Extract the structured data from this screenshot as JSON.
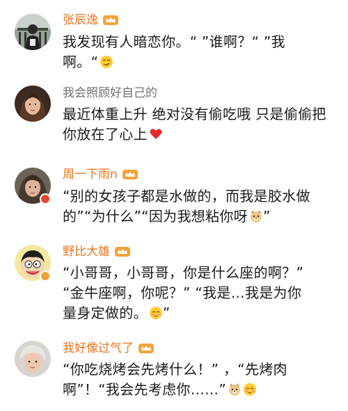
{
  "comments": [
    {
      "name": "张辰逸",
      "name_style": "orange",
      "has_vip": true,
      "lines": [
        "我发现有人暗恋你。“ ”谁啊？“ ”我",
        "啊。“"
      ],
      "emoji": "sly-smile-emoji"
    },
    {
      "name": "我会照顾好自己的",
      "name_style": "gray",
      "has_vip": false,
      "lines": [
        "最近体重上升 绝对没有偷吃哦 只是偷偷把",
        "你放在了心上"
      ],
      "emoji": "heart-icon"
    },
    {
      "name": "周一下雨n",
      "name_style": "orange",
      "has_vip": true,
      "lines": [
        "“别的女孩子都是水做的，而我是胶水做",
        "的”“为什么”“因为我想粘你呀",
        "”"
      ],
      "emoji": "doge-emoji"
    },
    {
      "name": "野比大雄",
      "name_style": "orange",
      "has_vip": true,
      "lines": [
        "“小哥哥，小哥哥，你是什么座的啊？”",
        "“金牛座啊，你呢？” “我是…我是为你",
        "量身定做的。",
        "”"
      ],
      "emoji": "shy-emoji"
    },
    {
      "name": "我好像过气了",
      "name_style": "orange",
      "has_vip": true,
      "lines": [
        "“你吃烧烤会先烤什么！”  ，“先烤肉",
        "啊”！“我会先考虑你……”"
      ],
      "emoji": "doge-and-shy-emoji"
    }
  ],
  "colors": {
    "name_orange": "#e8761f",
    "name_gray": "#6f6f6f",
    "text": "#1a1a1a",
    "vip_gold": "#f2a23a"
  }
}
